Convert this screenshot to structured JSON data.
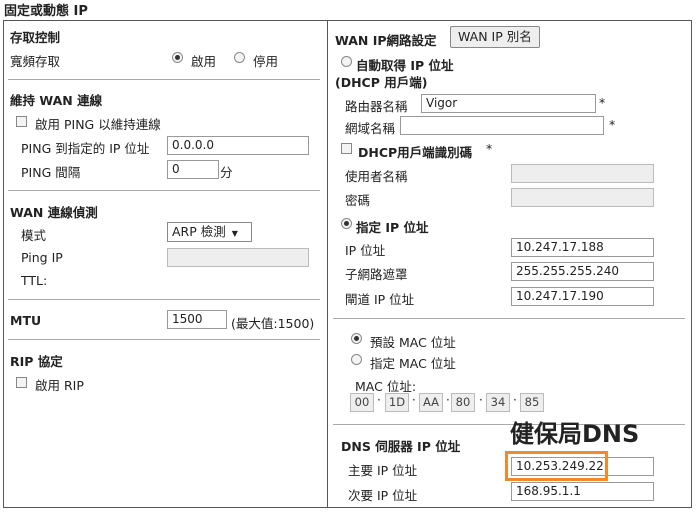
{
  "page_title": "固定或動態 IP",
  "left": {
    "access": {
      "header": "存取控制",
      "label": "寬頻存取",
      "opt_on": "啟用",
      "opt_off": "停用"
    },
    "keep": {
      "header": "維持 WAN 連線",
      "enable_label": "啟用 PING 以維持連線",
      "ping_ip_label": "PING 到指定的 IP 位址",
      "ping_ip_value": "0.0.0.0",
      "interval_label": "PING 間隔",
      "interval_value": "0",
      "interval_unit": "分"
    },
    "detect": {
      "header": "WAN 連線偵測",
      "mode_label": "模式",
      "mode_value": "ARP 檢測",
      "ping_ip_label": "Ping IP",
      "ttl_label": "TTL:"
    },
    "mtu": {
      "label": "MTU",
      "value": "1500",
      "max_text": "(最大值:1500)"
    },
    "rip": {
      "header": "RIP 協定",
      "enable_label": "啟用 RIP"
    }
  },
  "right": {
    "header": "WAN IP網路設定",
    "alias_button": "WAN IP 別名",
    "dhcp": {
      "label": "自動取得 IP 位址",
      "sublabel": "(DHCP 用戶端)",
      "router_name_label": "路由器名稱",
      "router_name_value": "Vigor",
      "asterisk": "*",
      "domain_label": "網域名稱",
      "domain_value": ""
    },
    "client_id": {
      "label": "DHCP用戶端識別碼",
      "asterisk": "*",
      "username_label": "使用者名稱",
      "password_label": "密碼"
    },
    "static": {
      "label": "指定 IP 位址",
      "ip_label": "IP 位址",
      "ip_value": "10.247.17.188",
      "mask_label": "子網路遮罩",
      "mask_value": "255.255.255.240",
      "gw_label": "閘道 IP 位址",
      "gw_value": "10.247.17.190"
    },
    "mac": {
      "default_label": "預設 MAC 位址",
      "specify_label": "指定 MAC 位址",
      "address_label": "MAC 位址:",
      "octets": [
        "00",
        "1D",
        "AA",
        "80",
        "34",
        "85"
      ]
    },
    "dns": {
      "header": "DNS 伺服器 IP 位址",
      "primary_label": "主要 IP 位址",
      "primary_value": "10.253.249.22",
      "secondary_label": "次要 IP 位址",
      "secondary_value": "168.95.1.1"
    }
  },
  "annotation": {
    "text": "健保局DNS",
    "color": "#f28a2a"
  }
}
